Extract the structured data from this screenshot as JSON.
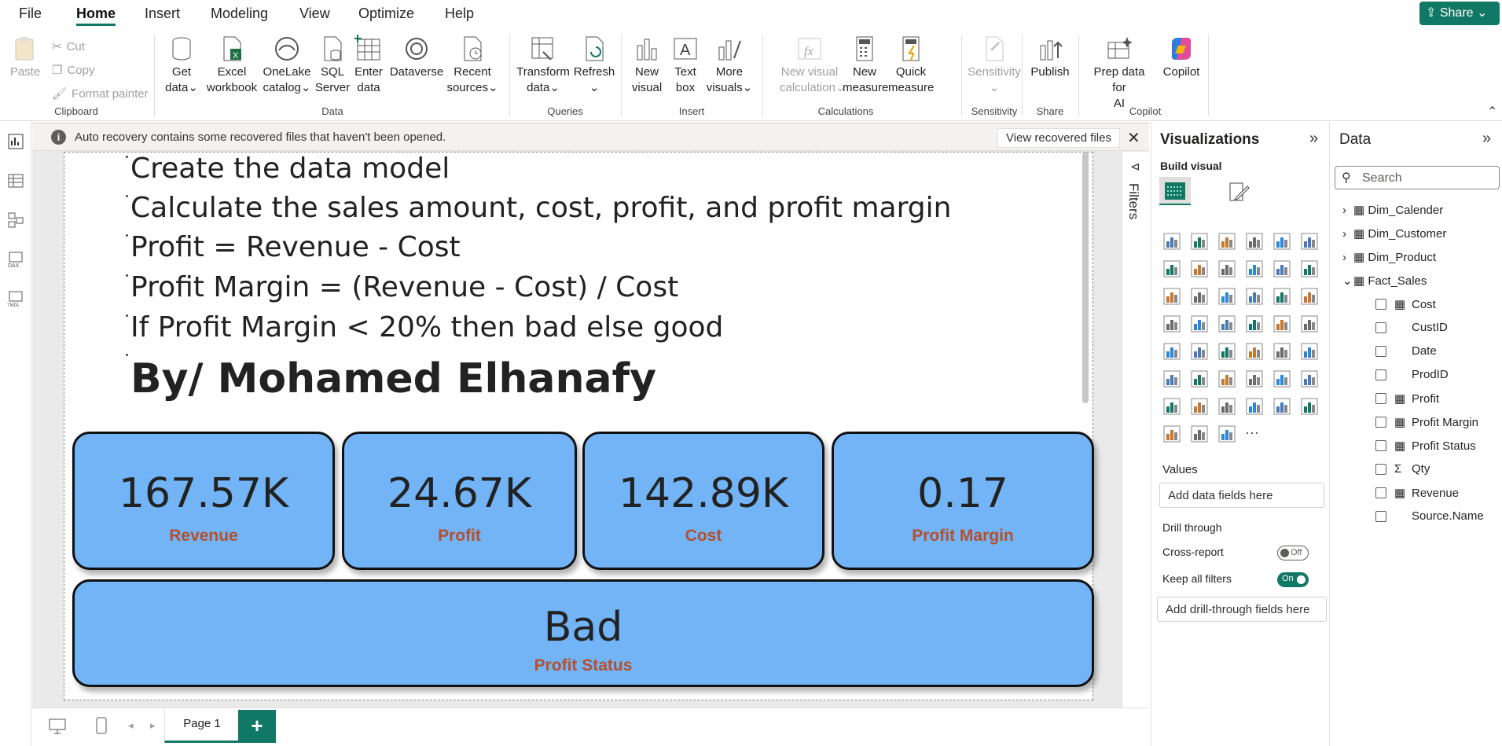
{
  "menu": {
    "tabs": [
      "File",
      "Home",
      "Insert",
      "Modeling",
      "View",
      "Optimize",
      "Help"
    ],
    "share_label": "Share"
  },
  "ribbon": {
    "clipboard": {
      "paste": "Paste",
      "cut": "Cut",
      "copy": "Copy",
      "format_painter": "Format painter",
      "group": "Clipboard"
    },
    "data": {
      "get_data": [
        "Get",
        "data"
      ],
      "excel": [
        "Excel",
        "workbook"
      ],
      "onelake": [
        "OneLake",
        "catalog"
      ],
      "sql": [
        "SQL",
        "Server"
      ],
      "enter": [
        "Enter",
        "data"
      ],
      "dataverse": "Dataverse",
      "recent": [
        "Recent",
        "sources"
      ],
      "group": "Data"
    },
    "queries": {
      "transform": [
        "Transform",
        "data"
      ],
      "refresh": "Refresh",
      "group": "Queries"
    },
    "insert": {
      "new_visual": [
        "New",
        "visual"
      ],
      "text_box": [
        "Text",
        "box"
      ],
      "more_visuals": [
        "More",
        "visuals"
      ],
      "group": "Insert"
    },
    "calculations": {
      "new_visual_calc": [
        "New visual",
        "calculation"
      ],
      "new_measure": [
        "New",
        "measure"
      ],
      "quick_measure": [
        "Quick",
        "measure"
      ],
      "group": "Calculations"
    },
    "sensitivity": {
      "label": "Sensitivity",
      "group": "Sensitivity"
    },
    "share": {
      "publish": "Publish",
      "group": "Share"
    },
    "copilot": {
      "prep": [
        "Prep data for",
        "AI"
      ],
      "copilot": "Copilot",
      "group": "Copilot"
    }
  },
  "notice": {
    "text": "Auto recovery contains some recovered files that haven't been opened.",
    "button": "View recovered files"
  },
  "report": {
    "bullets": [
      "Create the data model",
      "Calculate the sales amount, cost, profit, and profit margin",
      "Profit = Revenue - Cost",
      "Profit Margin = (Revenue - Cost) / Cost",
      "If Profit Margin < 20% then bad else good"
    ],
    "author": "By/ Mohamed Elhanafy",
    "cards": [
      {
        "value": "167.57K",
        "label": "Revenue"
      },
      {
        "value": "24.67K",
        "label": "Profit"
      },
      {
        "value": "142.89K",
        "label": "Cost"
      },
      {
        "value": "0.17",
        "label": "Profit Margin"
      }
    ],
    "status_card": {
      "value": "Bad",
      "label": "Profit Status"
    }
  },
  "pages": {
    "tab": "Page 1",
    "add": "+"
  },
  "filters_label": "Filters",
  "visualizations": {
    "title": "Visualizations",
    "build_visual": "Build visual",
    "values_label": "Values",
    "values_placeholder": "Add data fields here",
    "drill_through": "Drill through",
    "cross_report": "Cross-report",
    "cross_report_state": "Off",
    "keep_filters": "Keep all filters",
    "keep_filters_state": "On",
    "drill_placeholder": "Add drill-through fields here"
  },
  "data_pane": {
    "title": "Data",
    "search_placeholder": "Search",
    "tables": [
      "Dim_Calender",
      "Dim_Customer",
      "Dim_Product",
      "Fact_Sales"
    ],
    "fields": [
      {
        "name": "Cost",
        "icon": "calc"
      },
      {
        "name": "CustID",
        "icon": ""
      },
      {
        "name": "Date",
        "icon": ""
      },
      {
        "name": "ProdID",
        "icon": ""
      },
      {
        "name": "Profit",
        "icon": "calc"
      },
      {
        "name": "Profit Margin",
        "icon": "calc"
      },
      {
        "name": "Profit Status",
        "icon": "calc"
      },
      {
        "name": "Qty",
        "icon": "sigma"
      },
      {
        "name": "Revenue",
        "icon": "calc"
      },
      {
        "name": "Source.Name",
        "icon": ""
      }
    ]
  },
  "colors": {
    "accent": "#117865",
    "card_fill": "#73b4f7",
    "card_label": "#b5502c"
  }
}
